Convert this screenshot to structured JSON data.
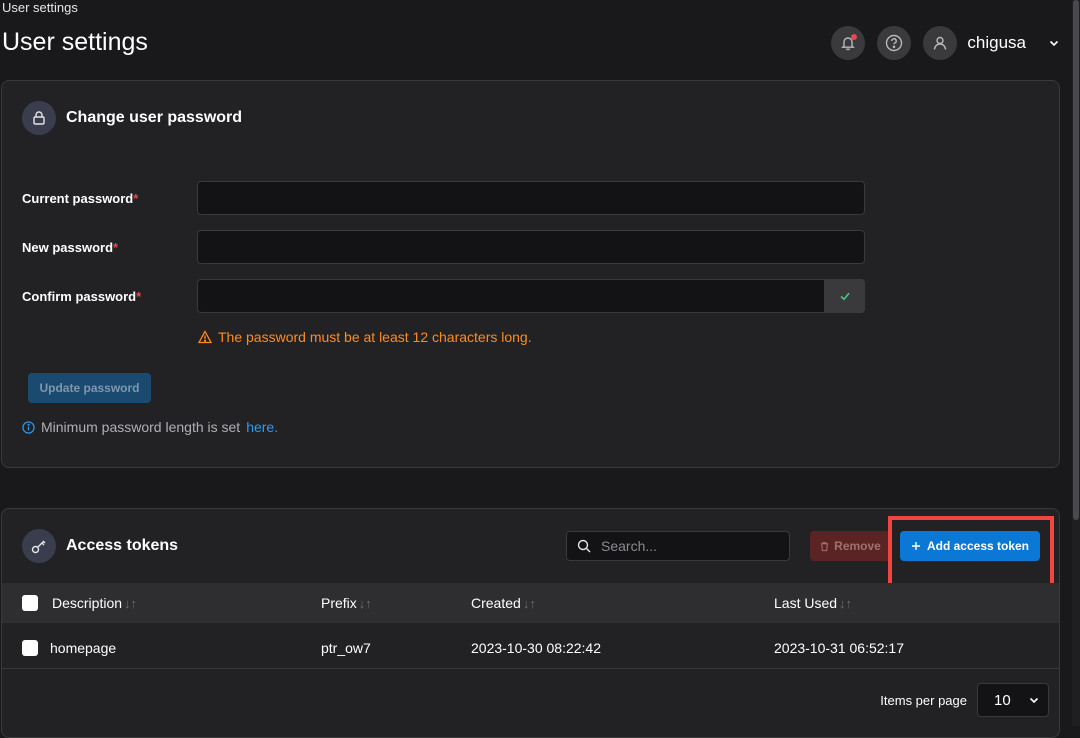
{
  "window": {
    "title": "User settings"
  },
  "header": {
    "page_title": "User settings",
    "username": "chigusa"
  },
  "password_panel": {
    "title": "Change user password",
    "fields": [
      {
        "label": "Current password",
        "required_mark": "*",
        "value": ""
      },
      {
        "label": "New password",
        "required_mark": "*",
        "value": ""
      },
      {
        "label": "Confirm password",
        "required_mark": "*",
        "value": ""
      }
    ],
    "warning": "The password must be at least 12 characters long.",
    "update_button": "Update password",
    "info_text": "Minimum password length is set",
    "info_link": "here."
  },
  "tokens_panel": {
    "title": "Access tokens",
    "search_placeholder": "Search...",
    "remove_button": "Remove",
    "add_button": "Add access token",
    "columns": [
      "Description",
      "Prefix",
      "Created",
      "Last Used"
    ],
    "rows": [
      {
        "description": "homepage",
        "prefix": "ptr_ow7",
        "created": "2023-10-30 08:22:42",
        "last_used": "2023-10-31 06:52:17"
      }
    ],
    "items_per_page_label": "Items per page",
    "items_per_page_value": "10"
  },
  "colors": {
    "accent": "#0a78d4",
    "warning": "#ff8b1f",
    "highlight": "#f0463f"
  }
}
